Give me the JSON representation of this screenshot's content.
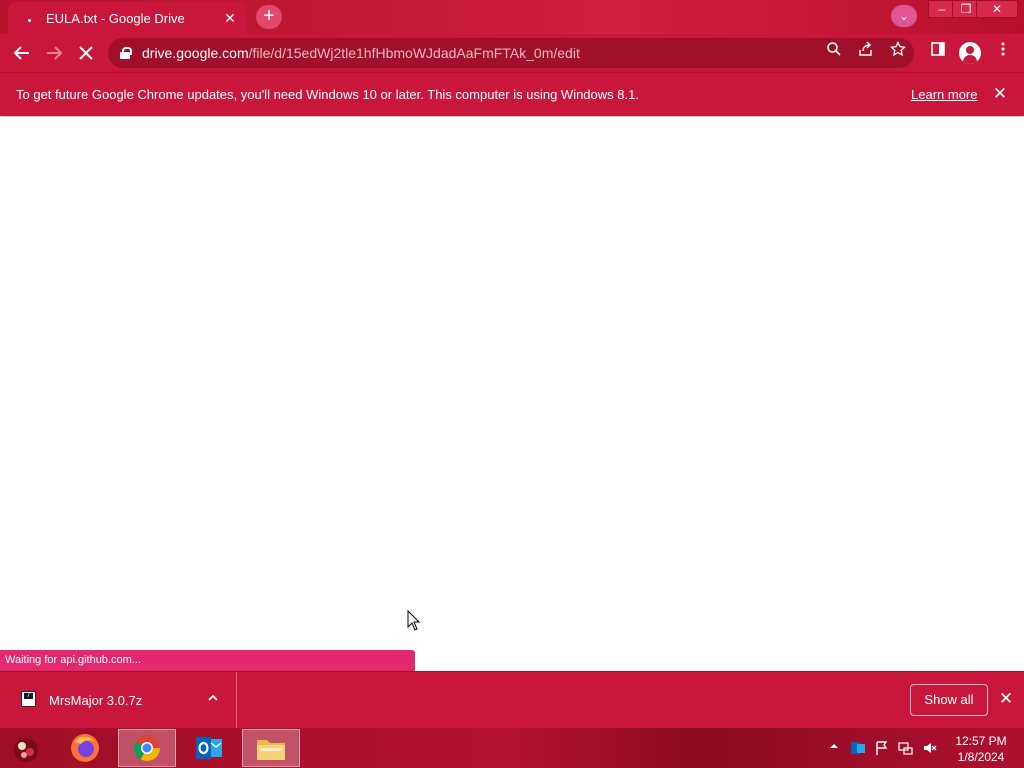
{
  "browser": {
    "tab": {
      "title": "EULA.txt - Google Drive",
      "close_glyph": "✕"
    },
    "new_tab_glyph": "+",
    "tab_search_glyph": "⌄",
    "window_controls": {
      "minimize": "–",
      "restore": "❐",
      "close": "✕"
    },
    "address": {
      "host": "drive.google.com",
      "path": "/file/d/15edWj2tle1hfHbmoWJdadAaFmFTAk_0m/edit"
    }
  },
  "infobar": {
    "message": "To get future Google Chrome updates, you'll need Windows 10 or later. This computer is using Windows 8.1.",
    "link": "Learn more",
    "close_glyph": "✕"
  },
  "status": {
    "text": "Waiting for api.github.com..."
  },
  "downloads": {
    "items": [
      {
        "name": "MrsMajor 3.0.7z"
      }
    ],
    "show_all": "Show all",
    "close_glyph": "✕"
  },
  "taskbar": {
    "apps": [
      "windows-start",
      "firefox",
      "chrome",
      "outlook",
      "file-explorer"
    ],
    "tray_outlook": "O",
    "clock": {
      "time": "12:57 PM",
      "date": "1/8/2024"
    }
  },
  "colors": {
    "theme_primary": "#c8173a",
    "theme_dark": "#a0102a",
    "status_bubble": "#e4286e"
  }
}
